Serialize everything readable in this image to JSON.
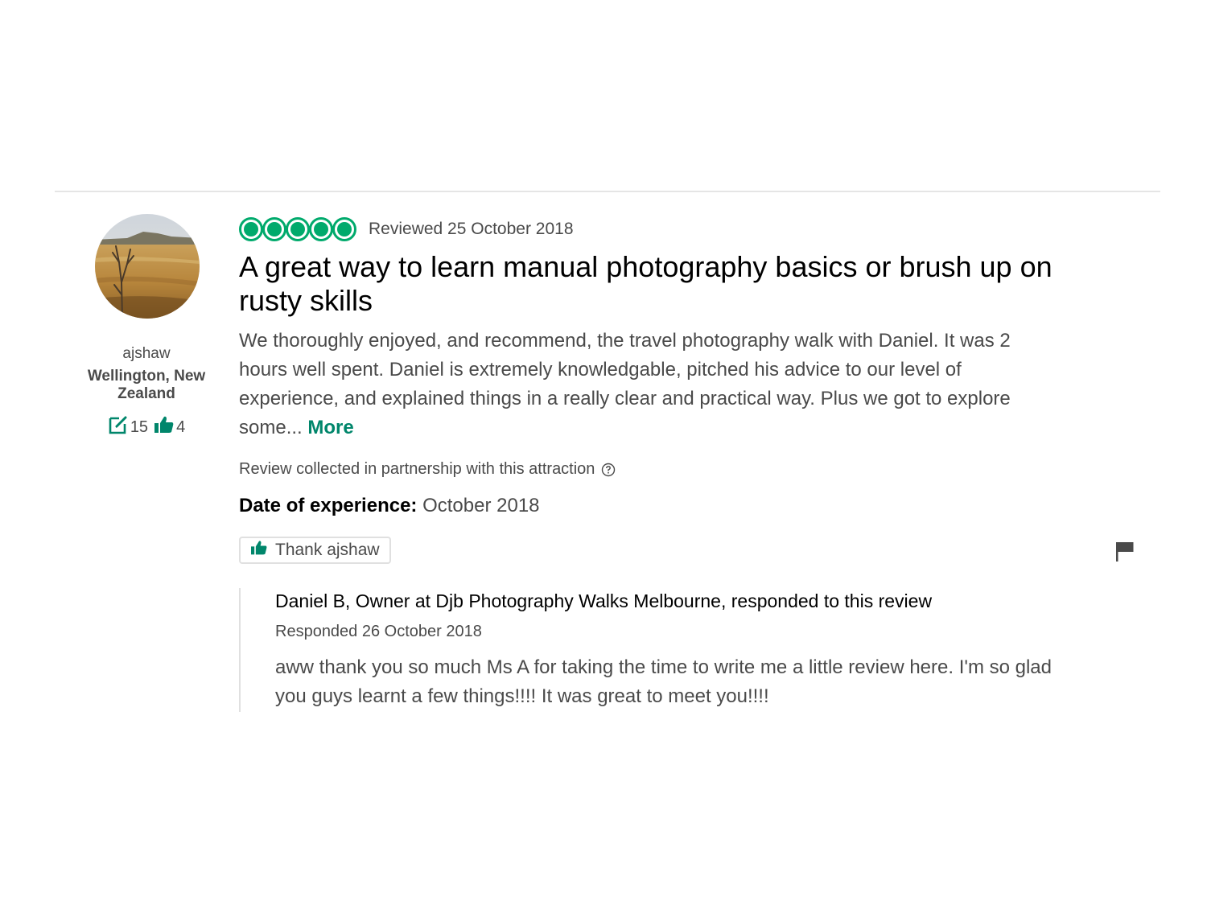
{
  "review": {
    "user": {
      "username": "ajshaw",
      "location": "Wellington, New Zealand",
      "contributions": "15",
      "helpful_votes": "4",
      "avatar_icon": "avatar-photo-landscape"
    },
    "rating": {
      "value": 5,
      "max": 5,
      "color": "#00aa6c"
    },
    "reviewed_date": "Reviewed 25 October 2018",
    "title": "A great way to learn manual photography basics or brush up on rusty skills",
    "body": "We thoroughly enjoyed, and recommend, the travel photography walk with Daniel. It was 2 hours well spent. Daniel is extremely knowledgable, pitched his advice to our level of experience, and explained things in a really clear and practical way. Plus we got to explore some...",
    "more_label": "More",
    "collected_note": "Review collected in partnership with this attraction",
    "experience": {
      "label": "Date of experience:",
      "value": "October 2018"
    },
    "thank_button_label": "Thank ajshaw",
    "accent_color": "#00866b"
  },
  "response": {
    "author": "Daniel B, Owner at Djb Photography Walks Melbourne, responded to this review",
    "date": "Responded 26 October 2018",
    "text": "aww thank you so much Ms A for taking the time to write me a little review here. I'm so glad you guys learnt a few things!!!! It was great to meet you!!!!"
  }
}
